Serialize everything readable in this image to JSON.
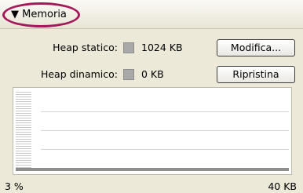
{
  "section": {
    "title": "Memoria",
    "expanded_icon": "triangle-down-icon"
  },
  "static_heap": {
    "label": "Heap statico:",
    "value": "1024 KB",
    "button": "Modifica..."
  },
  "dynamic_heap": {
    "label": "Heap dinamico:",
    "value": "0 KB",
    "button": "Ripristina"
  },
  "graph": {
    "percent_label": "3 %",
    "max_label": "40 KB"
  },
  "colors": {
    "highlight_ring": "#a3195b",
    "panel_bg": "#ece9d8",
    "swatch": "#a9a9a9"
  }
}
